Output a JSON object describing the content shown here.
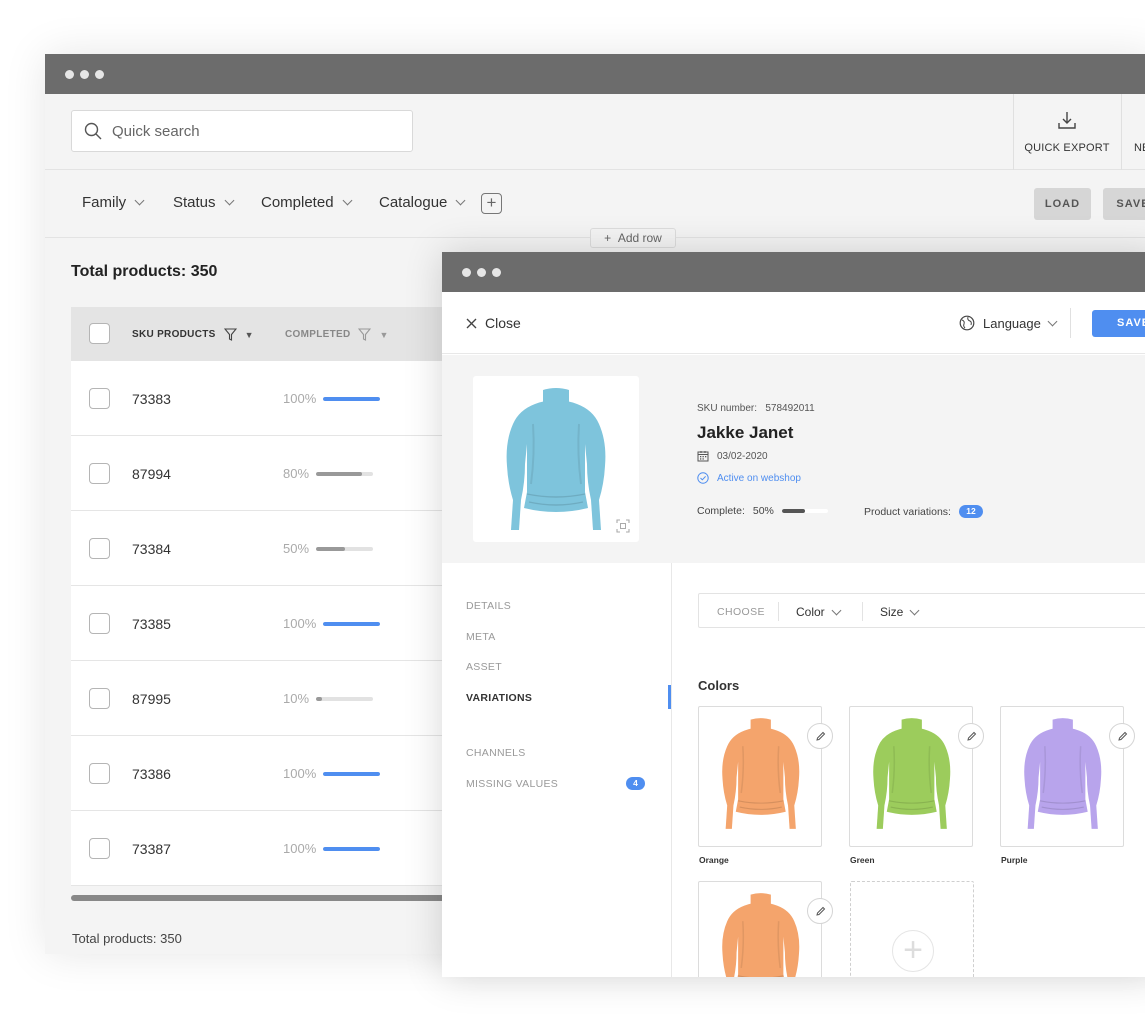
{
  "back_window": {
    "search": {
      "placeholder": "Quick search"
    },
    "toolbar": {
      "quick_export": "QUICK EXPORT",
      "new_label": "NE"
    },
    "filters": [
      "Family",
      "Status",
      "Completed",
      "Catalogue"
    ],
    "buttons": {
      "load": "LOAD",
      "save": "SAVE"
    },
    "add_row": "Add row",
    "total_title": "Total products: 350",
    "table": {
      "columns": [
        "SKU PRODUCTS",
        "COMPLETED"
      ],
      "rows": [
        {
          "sku": "73383",
          "completed": "100%",
          "progress": 1.0
        },
        {
          "sku": "87994",
          "completed": "80%",
          "progress": 0.8
        },
        {
          "sku": "73384",
          "completed": "50%",
          "progress": 0.5
        },
        {
          "sku": "73385",
          "completed": "100%",
          "progress": 1.0
        },
        {
          "sku": "87995",
          "completed": "10%",
          "progress": 0.1
        },
        {
          "sku": "73386",
          "completed": "100%",
          "progress": 1.0
        },
        {
          "sku": "73387",
          "completed": "100%",
          "progress": 1.0
        }
      ]
    },
    "total_footer": "Total products: 350"
  },
  "front_window": {
    "close_label": "Close",
    "language_label": "Language",
    "save_label": "SAVE",
    "product": {
      "sku_label": "SKU number:",
      "sku_value": "578492011",
      "name": "Jakke Janet",
      "date": "03/02-2020",
      "status": "Active on webshop",
      "complete_label": "Complete:",
      "complete_value": "50%",
      "complete_progress": 0.5,
      "variations_label": "Product variations:",
      "variations_count": "12"
    },
    "nav": {
      "items": [
        "DETAILS",
        "META",
        "ASSET",
        "VARIATIONS",
        "CHANNELS",
        "MISSING VALUES"
      ],
      "active": "VARIATIONS",
      "missing_values_count": "4"
    },
    "chooser": {
      "choose": "CHOOSE",
      "color": "Color",
      "size": "Size"
    },
    "colors_title": "Colors",
    "swatches": [
      {
        "label": "Orange",
        "color": "#f4a46c"
      },
      {
        "label": "Green",
        "color": "#9ccc5c"
      },
      {
        "label": "Purple",
        "color": "#b8a4ec"
      },
      {
        "label": "",
        "color": "#f4a46c"
      }
    ],
    "main_image_color": "#7ec4dc",
    "accent_color": "#4f8ef0"
  }
}
